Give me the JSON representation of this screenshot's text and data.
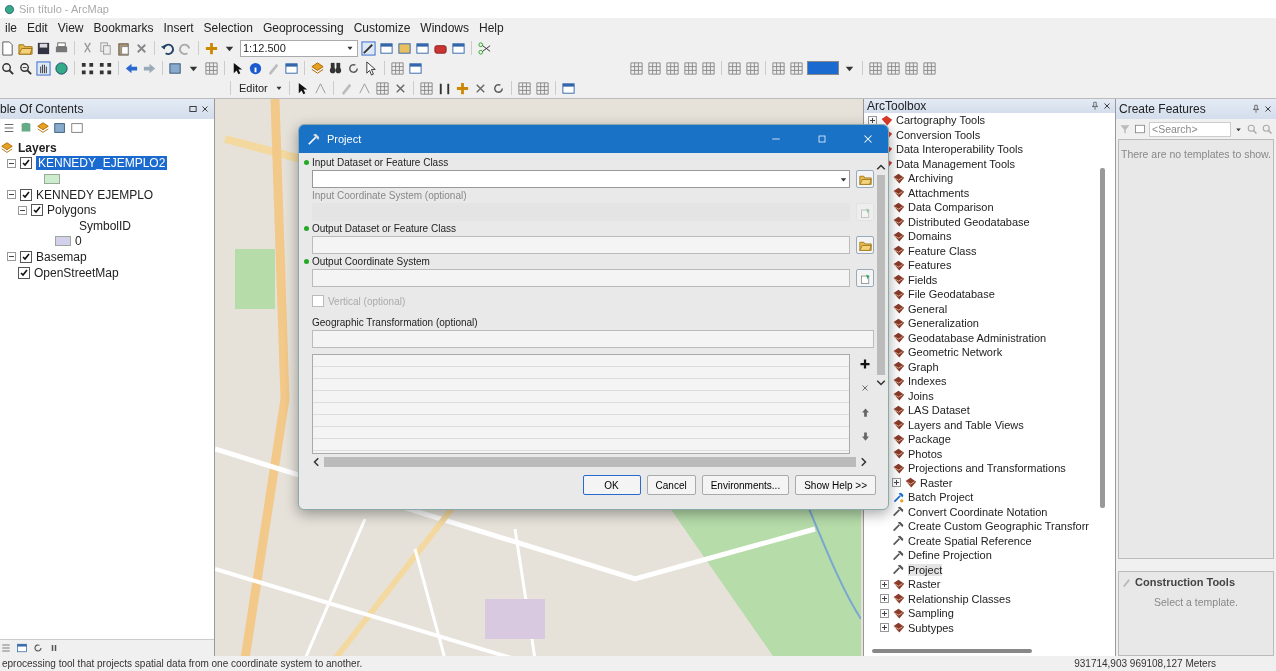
{
  "window": {
    "title": "Sin título - ArcMap"
  },
  "menu": [
    {
      "label": "ile"
    },
    {
      "label": "Edit"
    },
    {
      "label": "View"
    },
    {
      "label": "Bookmarks"
    },
    {
      "label": "Insert"
    },
    {
      "label": "Selection"
    },
    {
      "label": "Geoprocessing"
    },
    {
      "label": "Customize"
    },
    {
      "label": "Windows"
    },
    {
      "label": "Help"
    }
  ],
  "toolbar": {
    "scale": "1:12.500",
    "editor": "Editor"
  },
  "toc": {
    "title": "ble Of Contents",
    "tree": [
      {
        "kind": "group",
        "label": "Layers",
        "children": [
          {
            "kind": "layer",
            "label": "KENNEDY_EJEMPLO2",
            "checked": true,
            "expanded": true,
            "selected": true,
            "children": [
              {
                "kind": "symbol",
                "color": "#cdeccd"
              }
            ]
          },
          {
            "kind": "layer",
            "label": "KENNEDY EJEMPLO",
            "checked": true,
            "expanded": true,
            "selected": false,
            "children": [
              {
                "kind": "layer",
                "label": "Polygons",
                "checked": true,
                "expanded": true,
                "selected": false,
                "children": [
                  {
                    "kind": "field",
                    "label": "SymbolID"
                  },
                  {
                    "kind": "symbol",
                    "color": "#d4d0ec",
                    "label": "0"
                  }
                ]
              }
            ]
          },
          {
            "kind": "layer",
            "label": "Basemap",
            "checked": true,
            "expanded": true,
            "selected": false,
            "children": [
              {
                "kind": "leaf",
                "label": "OpenStreetMap",
                "checked": true,
                "selected": false
              }
            ]
          }
        ]
      }
    ]
  },
  "dialog": {
    "title": "Project",
    "params": [
      {
        "kind": "combo",
        "label": "Input Dataset or Feature Class",
        "required": true,
        "disabled": false,
        "browse": {
          "kind": "folder"
        }
      },
      {
        "kind": "text",
        "label": "Input Coordinate System (optional)",
        "required": false,
        "disabled": true,
        "browse": {
          "kind": "properties"
        }
      },
      {
        "kind": "text",
        "label": "Output Dataset or Feature Class",
        "required": true,
        "disabled": false,
        "browse": {
          "kind": "folder"
        }
      },
      {
        "kind": "text",
        "label": "Output Coordinate System",
        "required": true,
        "disabled": false,
        "browse": {
          "kind": "properties"
        }
      },
      {
        "kind": "checkbox",
        "label": "Vertical (optional)",
        "checked": false,
        "disabled": true
      },
      {
        "kind": "list",
        "label": "Geographic Transformation (optional)",
        "required": false,
        "disabled": false
      }
    ],
    "buttons": [
      {
        "label": "OK",
        "default": true
      },
      {
        "label": "Cancel",
        "default": false
      },
      {
        "label": "Environments...",
        "default": false
      },
      {
        "label": "Show Help >>",
        "default": false
      }
    ]
  },
  "toolbox": {
    "title": "ArcToolbox",
    "tree": [
      {
        "kind": "toolbox",
        "label": "Cartography Tools",
        "expanded": false
      },
      {
        "kind": "toolbox",
        "label": "Conversion Tools"
      },
      {
        "kind": "toolbox",
        "label": "Data Interoperability Tools"
      },
      {
        "kind": "toolbox",
        "label": "Data Management Tools",
        "children": [
          {
            "kind": "toolset",
            "label": "Archiving"
          },
          {
            "kind": "toolset",
            "label": "Attachments"
          },
          {
            "kind": "toolset",
            "label": "Data Comparison"
          },
          {
            "kind": "toolset",
            "label": "Distributed Geodatabase"
          },
          {
            "kind": "toolset",
            "label": "Domains"
          },
          {
            "kind": "toolset",
            "label": "Feature Class"
          },
          {
            "kind": "toolset",
            "label": "Features"
          },
          {
            "kind": "toolset",
            "label": "Fields"
          },
          {
            "kind": "toolset",
            "label": "File Geodatabase"
          },
          {
            "kind": "toolset",
            "label": "General"
          },
          {
            "kind": "toolset",
            "label": "Generalization"
          },
          {
            "kind": "toolset",
            "label": "Geodatabase Administration"
          },
          {
            "kind": "toolset",
            "label": "Geometric Network"
          },
          {
            "kind": "toolset",
            "label": "Graph"
          },
          {
            "kind": "toolset",
            "label": "Indexes"
          },
          {
            "kind": "toolset",
            "label": "Joins"
          },
          {
            "kind": "toolset",
            "label": "LAS Dataset"
          },
          {
            "kind": "toolset",
            "label": "Layers and Table Views"
          },
          {
            "kind": "toolset",
            "label": "Package"
          },
          {
            "kind": "toolset",
            "label": "Photos"
          },
          {
            "kind": "toolset",
            "label": "Projections and Transformations",
            "children": [
              {
                "kind": "toolset",
                "label": "Raster",
                "expanded": false
              },
              {
                "kind": "batch",
                "label": "Batch Project"
              },
              {
                "kind": "tool",
                "label": "Convert Coordinate Notation"
              },
              {
                "kind": "tool",
                "label": "Create Custom Geographic Transforr"
              },
              {
                "kind": "tool",
                "label": "Create Spatial Reference"
              },
              {
                "kind": "tool",
                "label": "Define Projection"
              },
              {
                "kind": "tool",
                "label": "Project",
                "selected": true
              }
            ]
          },
          {
            "kind": "toolset",
            "label": "Raster",
            "expanded": false
          },
          {
            "kind": "toolset",
            "label": "Relationship Classes",
            "expanded": false
          },
          {
            "kind": "toolset",
            "label": "Sampling",
            "expanded": false
          },
          {
            "kind": "toolset",
            "label": "Subtypes",
            "expanded": false
          }
        ]
      }
    ]
  },
  "create_features": {
    "title": "Create Features",
    "search": {
      "placeholder": "<Search>"
    },
    "message": "There are no templates to show.",
    "construction": {
      "title": "Construction Tools",
      "message": "Select a template."
    }
  },
  "status_bar": {
    "message": "eprocessing tool that projects spatial data from one coordinate system to another.",
    "coordinates": "931714,903  969108,127 Meters"
  }
}
